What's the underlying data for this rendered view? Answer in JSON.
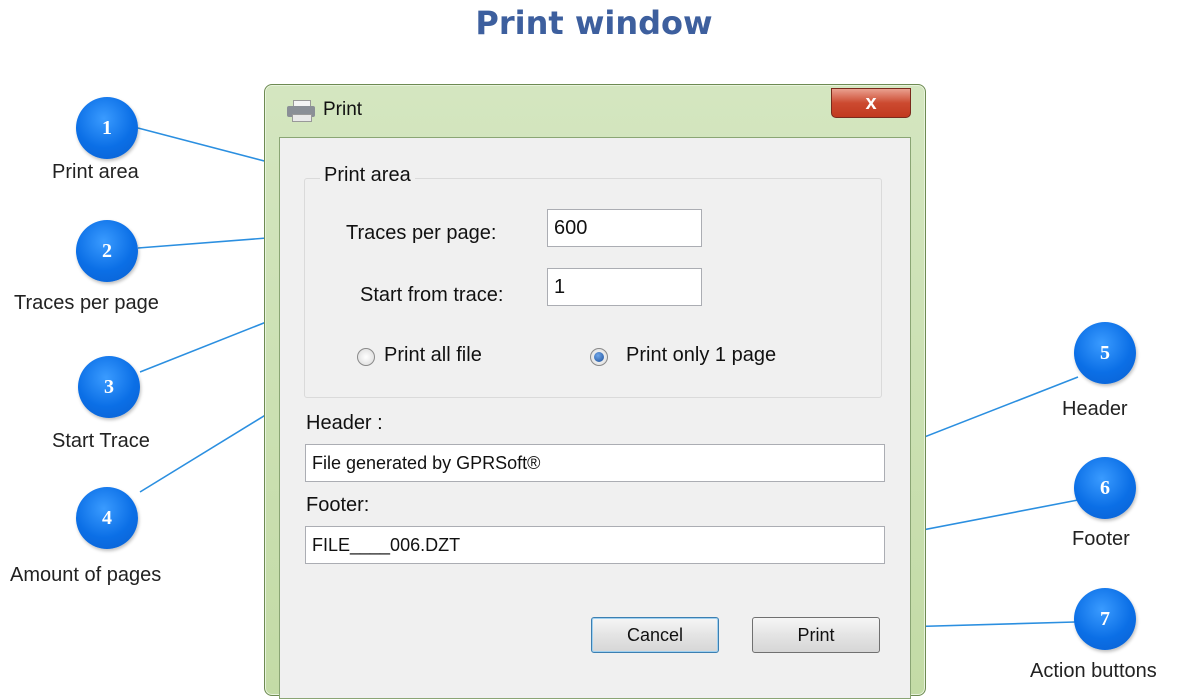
{
  "page_title": "Print window",
  "window": {
    "title": "Print",
    "close_glyph": "x",
    "group_label": "Print area",
    "traces_label": "Traces per page:",
    "traces_value": "600",
    "start_label": "Start from trace:",
    "start_value": "1",
    "radio_all_label": "Print all file",
    "radio_one_label": "Print only 1 page",
    "radio_selected": "Print only 1 page",
    "header_label": "Header :",
    "header_value": "File generated by GPRSoft®",
    "footer_label": "Footer:",
    "footer_value": "FILE____006.DZT",
    "cancel_label": "Cancel",
    "print_label": "Print"
  },
  "callouts": [
    {
      "number": "1",
      "label": "Print area"
    },
    {
      "number": "2",
      "label": "Traces per page"
    },
    {
      "number": "3",
      "label": "Start Trace"
    },
    {
      "number": "4",
      "label": "Amount of pages"
    },
    {
      "number": "5",
      "label": "Header"
    },
    {
      "number": "6",
      "label": "Footer"
    },
    {
      "number": "7",
      "label": "Action buttons"
    }
  ],
  "colors": {
    "title": "#3d5f9e",
    "badge": "#0b6fe6",
    "leader_line": "#2b8fe0",
    "window_frame": "#c3dba6"
  }
}
